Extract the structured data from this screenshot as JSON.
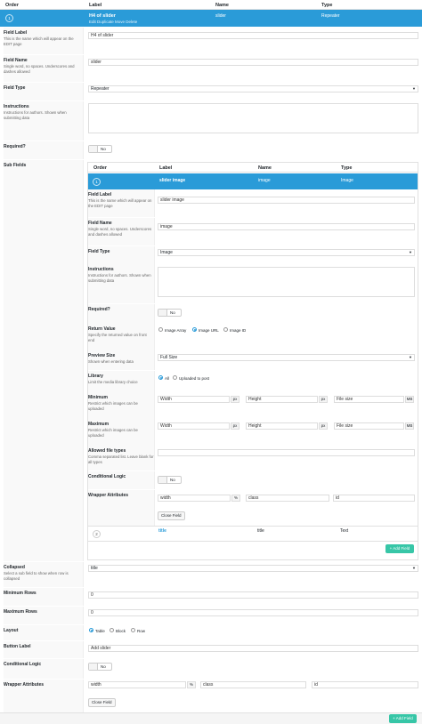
{
  "header": {
    "order": "Order",
    "label": "Label",
    "name": "Name",
    "type": "Type"
  },
  "selected": {
    "index": "1",
    "title": "H4 of slider",
    "actions": "Edit   Duplicate   Move   Delete",
    "name": "slider",
    "type": "Repeater"
  },
  "fields": {
    "label": {
      "title": "Field Label",
      "desc": "This is the name which will appear on the EDIT page",
      "value": "H4 of slider"
    },
    "name": {
      "title": "Field Name",
      "desc": "Single word, no spaces. Underscores and dashes allowed",
      "value": "slider"
    },
    "type": {
      "title": "Field Type",
      "value": "Repeater"
    },
    "instructions": {
      "title": "Instructions",
      "desc": "Instructions for authors. Shown when submitting data"
    },
    "required": {
      "title": "Required?",
      "toggle": "No"
    },
    "subfields": {
      "title": "Sub Fields"
    },
    "collapsed": {
      "title": "Collapsed",
      "desc": "Select a sub field to show when row is collapsed",
      "value": "title"
    },
    "min_rows": {
      "title": "Minimum Rows",
      "value": "0"
    },
    "max_rows": {
      "title": "Maximum Rows",
      "value": "0"
    },
    "layout": {
      "title": "Layout",
      "options": [
        "Table",
        "Block",
        "Row"
      ]
    },
    "button_label": {
      "title": "Button Label",
      "value": "Add slider"
    },
    "cond": {
      "title": "Conditional Logic",
      "toggle": "No"
    },
    "wrapper": {
      "title": "Wrapper Attributes",
      "width": "width",
      "pct": "%",
      "class": "class",
      "id": "id"
    },
    "close": "Close Field",
    "add": "+ Add Field"
  },
  "sub": {
    "header": {
      "order": "Order",
      "label": "Label",
      "name": "Name",
      "type": "Type"
    },
    "selected": {
      "index": "1",
      "title": "slider image",
      "name": "image",
      "type": "Image"
    },
    "label": {
      "title": "Field Label",
      "desc": "This is the name which will appear on the EDIT page",
      "value": "slider image"
    },
    "name": {
      "title": "Field Name",
      "desc": "Single word, no spaces. Underscores and dashes allowed",
      "value": "image"
    },
    "type": {
      "title": "Field Type",
      "value": "Image"
    },
    "instructions": {
      "title": "Instructions",
      "desc": "Instructions for authors. Shown when submitting data"
    },
    "required": {
      "title": "Required?",
      "toggle": "No"
    },
    "return": {
      "title": "Return Value",
      "desc": "Specify the returned value on front end",
      "options": [
        "Image Array",
        "Image URL",
        "Image ID"
      ]
    },
    "preview": {
      "title": "Preview Size",
      "desc": "Shown when entering data",
      "value": "Full Size"
    },
    "library": {
      "title": "Library",
      "desc": "Limit the media library choice",
      "options": [
        "All",
        "Uploaded to post"
      ]
    },
    "minimum": {
      "title": "Minimum",
      "desc": "Restrict which images can be uploaded",
      "width": "Width",
      "height": "Height",
      "size": "File size",
      "px": "px",
      "mb": "MB"
    },
    "maximum": {
      "title": "Maximum",
      "desc": "Restrict which images can be uploaded",
      "width": "Width",
      "height": "Height",
      "size": "File size",
      "px": "px",
      "mb": "MB"
    },
    "allowed": {
      "title": "Allowed file types",
      "desc": "Comma separated list. Leave blank for all types"
    },
    "cond": {
      "title": "Conditional Logic",
      "toggle": "No"
    },
    "wrapper": {
      "title": "Wrapper Attributes",
      "width": "width",
      "pct": "%",
      "class": "class",
      "id": "id"
    },
    "close": "Close Field",
    "row2": {
      "index": "2",
      "title": "title",
      "name": "title",
      "type": "Text"
    },
    "add": "+ Add Field"
  },
  "colors": {
    "accent": "#2a9bd8",
    "add": "#37c6a7"
  }
}
